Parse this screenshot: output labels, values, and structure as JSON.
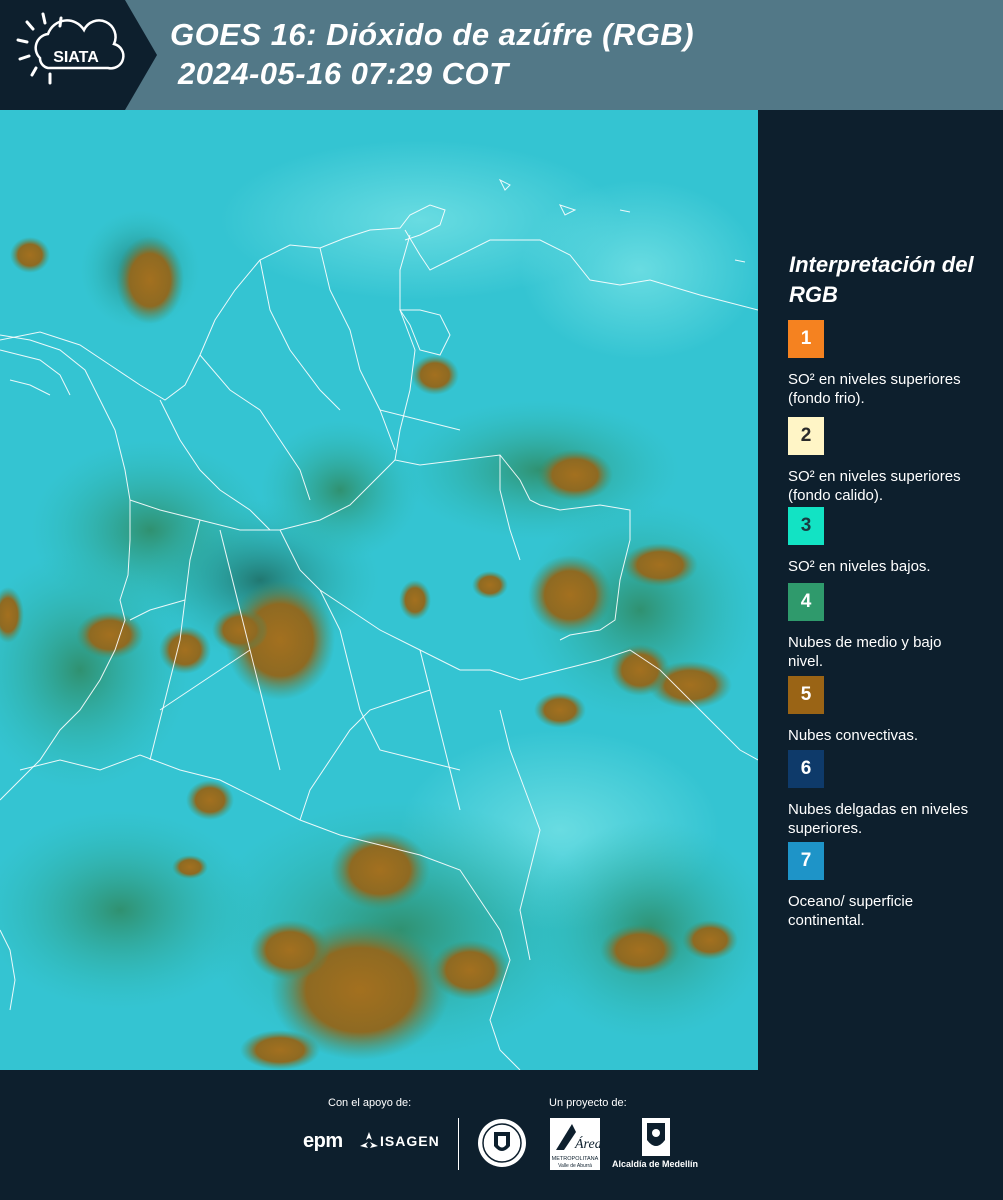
{
  "header": {
    "logo_text": "SIATA",
    "title_line1": "GOES 16: Dióxido de azúfre (RGB)",
    "title_line2": "2024-05-16 07:29 COT"
  },
  "legend": {
    "title": "Interpretación del RGB",
    "items": [
      {
        "number": "1",
        "label": "SO² en niveles superiores (fondo frio).",
        "color": "#f58220",
        "text_color": "#ffffff"
      },
      {
        "number": "2",
        "label": "SO² en niveles superiores (fondo calido).",
        "color": "#fff5c6",
        "text_color": "#2a2a2a"
      },
      {
        "number": "3",
        "label": "SO² en niveles bajos.",
        "color": "#12e3c4",
        "text_color": "#1a3a40"
      },
      {
        "number": "4",
        "label": "Nubes de medio y bajo nivel.",
        "color": "#2f9a6c",
        "text_color": "#ffffff"
      },
      {
        "number": "5",
        "label": "Nubes convectivas.",
        "color": "#9a6415",
        "text_color": "#ffffff"
      },
      {
        "number": "6",
        "label": "Nubes delgadas en niveles superiores.",
        "color": "#0e3a6a",
        "text_color": "#ffffff"
      },
      {
        "number": "7",
        "label": "Oceano/ superficie continental.",
        "color": "#1e94c8",
        "text_color": "#ffffff"
      }
    ]
  },
  "footer": {
    "support_label": "Con el apoyo de:",
    "project_label": "Un proyecto de:",
    "sponsor1": "epm",
    "sponsor2": "ISAGEN",
    "area_logo_text": "Área",
    "area_sub1": "METROPOLITANA",
    "area_sub2": "Valle de Aburrá",
    "alcaldia": "Alcaldía de Medellín"
  },
  "colors": {
    "header_bg": "#527887",
    "logo_bg": "#0d1f2d",
    "ocean_cyan": "#2fc6d3",
    "cloud_green": "#2f9a6c",
    "cloud_brown": "#9a6415"
  }
}
